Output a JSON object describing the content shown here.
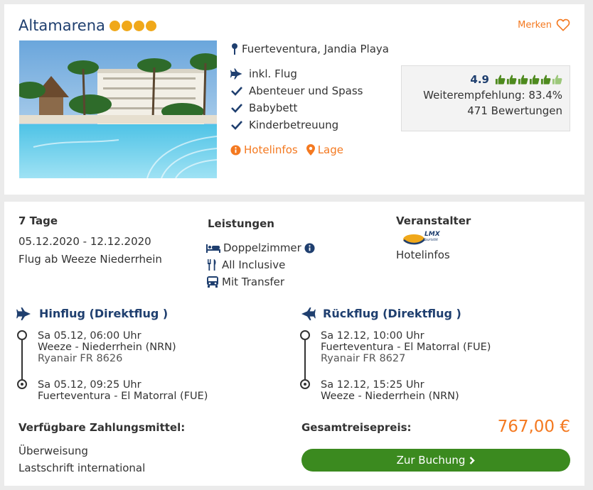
{
  "hotel": {
    "name": "Altamarena",
    "star_count": 4,
    "merken_label": "Merken",
    "location": "Fuerteventura, Jandia Playa",
    "features": [
      {
        "icon": "plane-icon",
        "label": "inkl. Flug"
      },
      {
        "icon": "check-icon",
        "label": "Abenteuer und Spass"
      },
      {
        "icon": "check-icon",
        "label": "Babybett"
      },
      {
        "icon": "check-icon",
        "label": "Kinderbetreuung"
      }
    ],
    "links": {
      "hotelinfos": "Hotelinfos",
      "lage": "Lage"
    },
    "rating": {
      "score": "4.9",
      "recommendation": "Weiterempfehlung: 83.4%",
      "reviews": "471 Bewertungen",
      "thumbs_full": 5,
      "thumbs_partial": 1
    }
  },
  "trip": {
    "duration": "7 Tage",
    "dates": "05.12.2020 - 12.12.2020",
    "departure": "Flug ab Weeze Niederrhein"
  },
  "services": {
    "title": "Leistungen",
    "items": [
      "Doppelzimmer",
      "All Inclusive",
      "Mit Transfer"
    ]
  },
  "operator": {
    "title": "Veranstalter",
    "logo_text": "LMX",
    "logo_subtext": "Touristik",
    "link": "Hotelinfos"
  },
  "outbound": {
    "title": "Hinflug (Direktflug )",
    "dep_time": "Sa 05.12, 06:00 Uhr",
    "dep_airport": "Weeze - Niederrhein (NRN)",
    "flight": "Ryanair FR 8626",
    "arr_time": "Sa 05.12, 09:25 Uhr",
    "arr_airport": "Fuerteventura - El Matorral (FUE)"
  },
  "return": {
    "title": "Rückflug (Direktflug )",
    "dep_time": "Sa 12.12, 10:00 Uhr",
    "dep_airport": "Fuerteventura - El Matorral (FUE)",
    "flight": "Ryanair FR 8627",
    "arr_time": "Sa 12.12, 15:25 Uhr",
    "arr_airport": "Weeze - Niederrhein (NRN)"
  },
  "payment": {
    "title": "Verfügbare Zahlungsmittel:",
    "methods": [
      "Überweisung",
      "Lastschrift international"
    ]
  },
  "total": {
    "label": "Gesamtreisepreis:",
    "price": "767,00 €",
    "button": "Zur Buchung"
  },
  "colors": {
    "brand_blue": "#1f3f6f",
    "accent_orange": "#f47920",
    "book_green": "#3b8a1f",
    "star": "#f0a81a",
    "thumb_green": "#4e8a1e"
  }
}
